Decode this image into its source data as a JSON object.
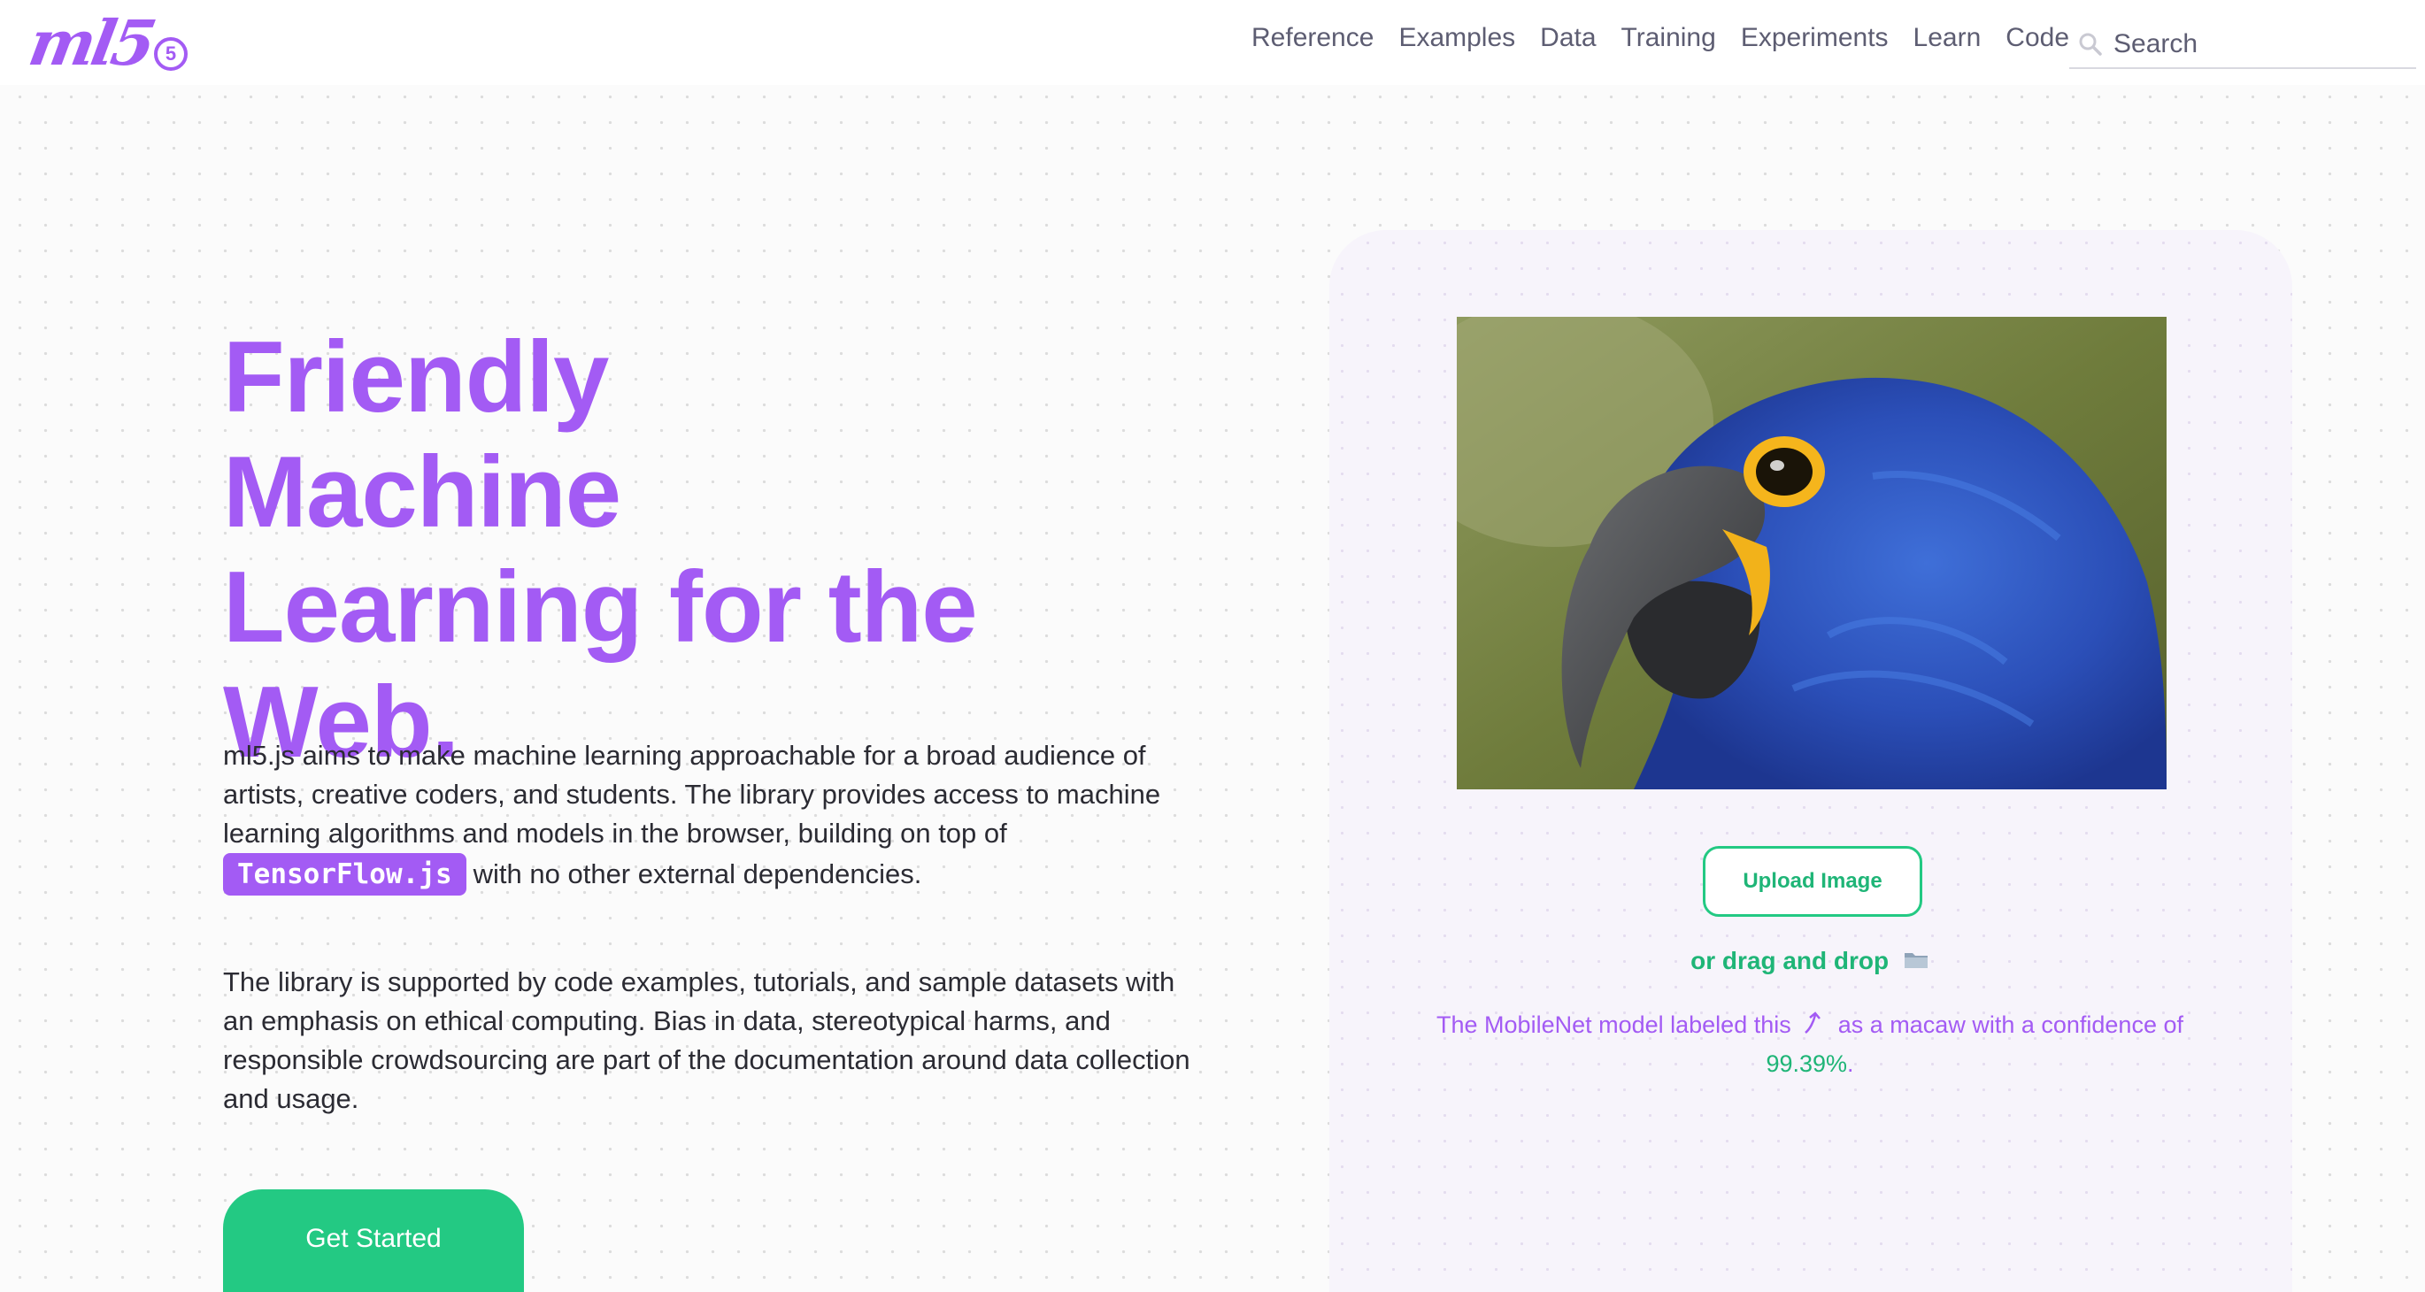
{
  "header": {
    "logo_text": "ml5",
    "logo_badge": "5",
    "nav": [
      "Reference",
      "Examples",
      "Data",
      "Training",
      "Experiments",
      "Learn",
      "Code"
    ],
    "search_placeholder": "Search"
  },
  "hero": {
    "title_line1": "Friendly Machine",
    "title_line2": "Learning for the",
    "title_line3": "Web.",
    "para1_before": "ml5.js aims to make machine learning approachable for a broad audience of artists, creative coders, and students. The library provides access to machine learning algorithms and models in the browser, building on top of",
    "tf_badge": "TensorFlow.js",
    "para1_after": "with no other external dependencies.",
    "para2": "The library is supported by code examples, tutorials, and sample datasets with an emphasis on ethical computing. Bias in data, stereotypical harms, and responsible crowdsourcing are part of the documentation around data collection and usage.",
    "get_started": "Get Started"
  },
  "demo": {
    "image_alt": "blue macaw",
    "upload_label": "Upload Image",
    "drag_text": "or drag and drop",
    "caption_before": "The MobileNet model labeled this",
    "caption_middle": "as a macaw with a confidence of",
    "confidence": "99.39%",
    "caption_end": "."
  },
  "colors": {
    "brand_purple": "#a35bf4",
    "brand_green": "#23c983",
    "text_dark": "#2b2b33",
    "nav_text": "#5d5d72"
  },
  "icons": {
    "search": "search-icon",
    "folder": "folder-icon",
    "arrow": "curved-arrow-icon"
  }
}
